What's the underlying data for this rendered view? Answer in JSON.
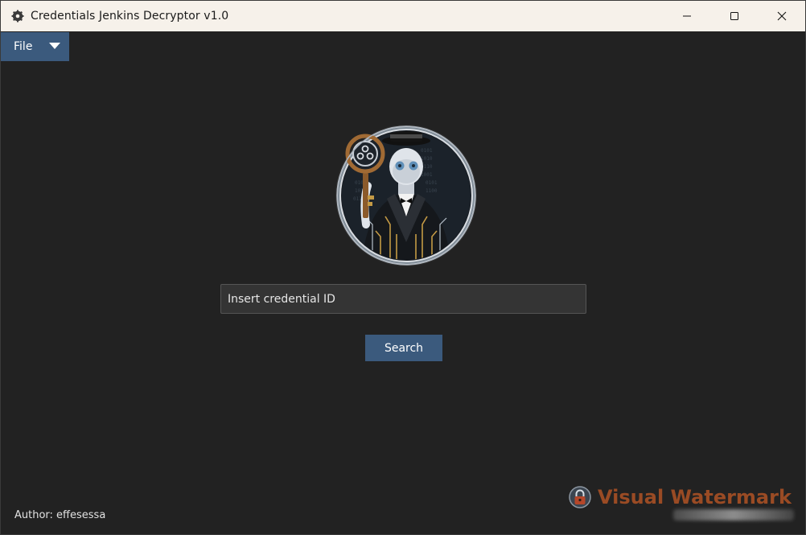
{
  "window": {
    "title": "Credentials Jenkins Decryptor v1.0",
    "icon": "app-gear-icon",
    "controls": [
      "minimize-icon",
      "maximize-icon",
      "close-icon"
    ]
  },
  "menu": {
    "file_label": "File",
    "file_icon": "caret-down-icon"
  },
  "logo": {
    "description_icon": "butler-robot-logo"
  },
  "form": {
    "credential_value": "Insert credential ID",
    "search_label": "Search"
  },
  "footer": {
    "author": "Author: effesessa"
  },
  "watermark": {
    "text": "Visual Watermark",
    "icon": "lock-icon"
  },
  "colors": {
    "background": "#222222",
    "accent": "#3b5a7d",
    "titlebar": "#f6f1ea",
    "watermark": "#9a4b24"
  }
}
